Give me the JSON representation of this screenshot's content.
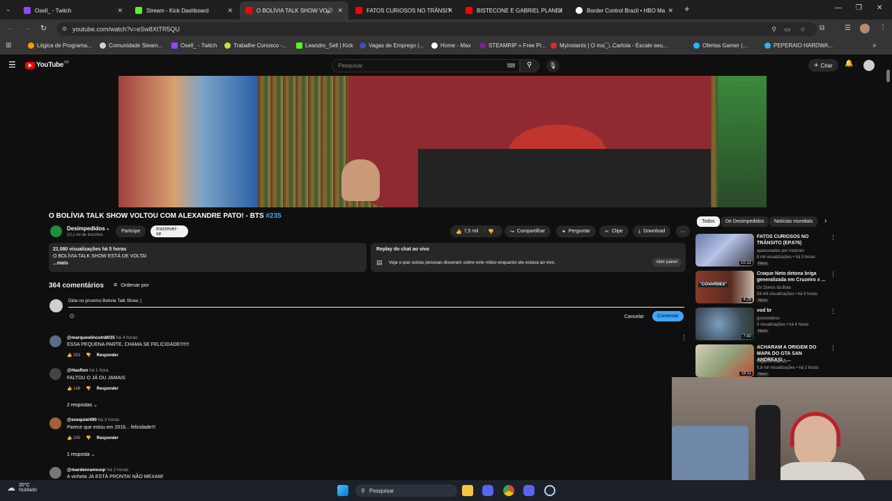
{
  "browser": {
    "tabs": [
      {
        "label": "Osell_ - Twitch",
        "color": "#9146ff",
        "active": false
      },
      {
        "label": "Stream - Kick Dashboard",
        "color": "#53fc18",
        "active": false
      },
      {
        "label": "O BOLÍVIA TALK SHOW VO",
        "color": "#ff0000",
        "active": true
      },
      {
        "label": "FATOS CURIOSOS NO TRÂNSIT",
        "color": "#ff0000",
        "active": false
      },
      {
        "label": "BISTECONE E GABRIEL PLANEJ",
        "color": "#ff0000",
        "active": false
      },
      {
        "label": "Border Control Brazil • HBO Ma",
        "color": "#ffffff",
        "active": false
      }
    ],
    "url": "youtube.com/watch?v=eSw8XtTR5QU",
    "bookmarks": [
      {
        "label": "Lógica de Programa...",
        "color": "#ff9800"
      },
      {
        "label": "Comunidade Steam...",
        "color": "#c7d5e0"
      },
      {
        "label": "Osell_ - Twitch",
        "color": "#9146ff"
      },
      {
        "label": "Trabalhe Conosco -...",
        "color": "#cddc39"
      },
      {
        "label": "Leandro_Sell | Kick",
        "color": "#53fc18"
      },
      {
        "label": "Vagas de Emprego |...",
        "color": "#3f51b5"
      },
      {
        "label": "Home - Max",
        "color": "#ffffff"
      },
      {
        "label": "STEAMRIP » Free Pr...",
        "color": "#7b1fa2"
      },
      {
        "label": "Myinstants | O maio...",
        "color": "#d32f2f"
      },
      {
        "label": "Cartola - Escale seu...",
        "color": "#333333"
      },
      {
        "label": "Ofertas Gamer (...",
        "color": "#29b6f6"
      },
      {
        "label": "PEPERAIO HARDWA...",
        "color": "#29b6f6"
      }
    ]
  },
  "youtube": {
    "logo": "YouTube",
    "country": "BR",
    "search_placeholder": "Pesquisar",
    "create_label": "Criar"
  },
  "video": {
    "title": "O BOLÍVIA TALK SHOW VOLTOU COM ALEXANDRE PATO! - BTS",
    "hashtag": "#235",
    "channel": "Desimpedidos",
    "subscribers": "10,1 mi de inscritos",
    "join_label": "Participe",
    "subscribe_label": "Inscrever-se",
    "likes": "7,5 mil",
    "share_label": "Compartilhar",
    "ask_label": "Perguntar",
    "clip_label": "Clipe",
    "download_label": "Download",
    "description_stats": "21.080 visualizações  há 5 horas",
    "description_text": "O BOLÍVIA TALK SHOW ESTÁ DE VOLTA!",
    "description_more": "...mais",
    "chat_title": "Replay do chat ao vivo",
    "chat_text": "Veja o que outras pessoas disseram sobre este vídeo enquanto ele estava ao vivo.",
    "chat_button": "Abrir painel"
  },
  "comments": {
    "count_label": "364 comentários",
    "sort_label": "Ordenar por",
    "draft": "Dida no proximo Bolívia Talk Show, |",
    "cancel_label": "Cancelar",
    "submit_label": "Comentar",
    "items": [
      {
        "user": "@marqueslincoln8035",
        "time": "há 4 horas",
        "text": "ESSA PEQUENA PARTE, CHAMA SE FELICIDADE!!!!!!!",
        "likes": "383",
        "reply": "Responder",
        "avatar": "#5d6b8a"
      },
      {
        "user": "@Hasflon",
        "time": "há 1 hora",
        "text": "FALTOU O JÁ OU JAMAIS",
        "likes": "148",
        "reply": "Responder",
        "replies": "2 respostas",
        "avatar": "#444444"
      },
      {
        "user": "@ezequiel490",
        "time": "há 3 horas",
        "text": "Parece que estou em 2016... felicidade!!!",
        "likes": "245",
        "reply": "Responder",
        "replies": "1 resposta",
        "avatar": "#a0623a"
      },
      {
        "user": "@mardenramosqr",
        "time": "há 2 horas",
        "text": "A vinheta JÁ ESTÁ PRONTA! NÃO MEXAM!",
        "avatar": "#777777"
      }
    ]
  },
  "sidebar": {
    "chips": [
      "Todos",
      "De Desimpedidos",
      "Notícias mundiais"
    ],
    "items": [
      {
        "title": "FATOS CURIOSOS NO TRÂNSITO (EP.676)",
        "channel": "apaixonados por motores",
        "meta": "8 mil visualizações • há 3 horas",
        "badge": "Novo",
        "duration": "10:12",
        "thumb": "#6c7aa8"
      },
      {
        "title": "Craque Neto detona briga generalizada em Cruzeiro x ...",
        "channel": "Os Donos da Bola",
        "meta": "59 mil visualizações • há 9 horas",
        "badge": "Novo",
        "duration": "4:28",
        "thumb": "#8a3a2a",
        "thumb_text": "\"COVARDES\""
      },
      {
        "title": "vod br",
        "channel": "gooooodess",
        "meta": "3 visualizações • há 4 horas",
        "badge": "Novo",
        "duration": "7:40",
        "thumb": "#3d4d5a"
      },
      {
        "title": "ACHARAM A ORIGEM DO MAPA DO GTA SAN ANDREAS! - ...",
        "channel": "Gigacon Games",
        "meta": "5,8 mil visualizações • há 2 horas",
        "badge": "Novo",
        "duration": "18:11",
        "thumb": "#d6cfb8"
      }
    ]
  },
  "taskbar": {
    "weather_temp": "20°C",
    "weather_desc": "Nublado",
    "search_label": "Pesquisar"
  }
}
